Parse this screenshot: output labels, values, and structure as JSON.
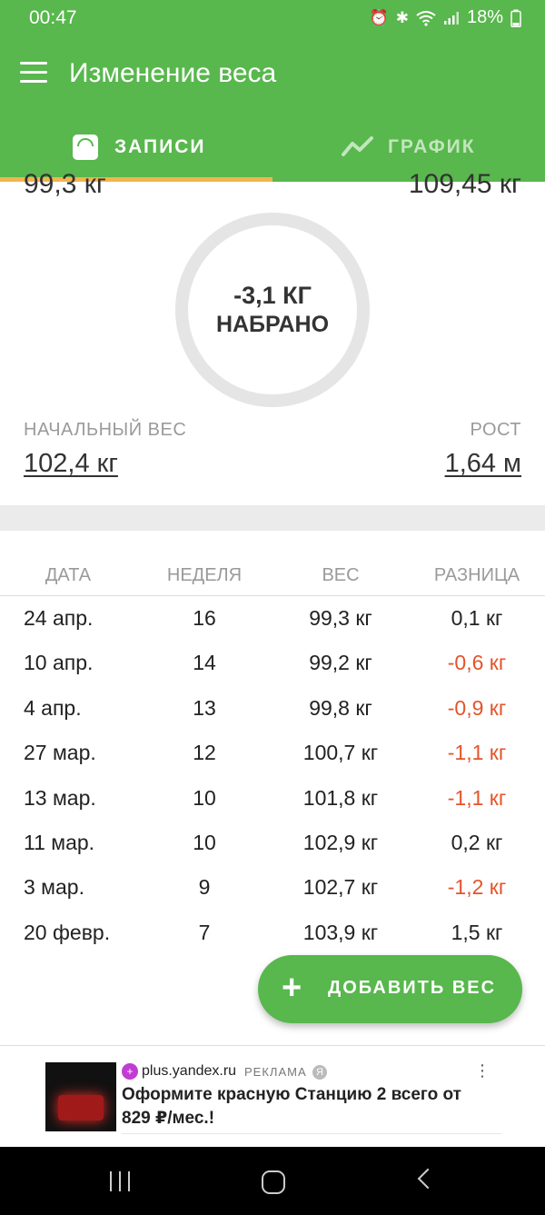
{
  "status_bar": {
    "time": "00:47",
    "battery": "18%",
    "icons": [
      "alarm-icon",
      "bluetooth-icon",
      "wifi-icon",
      "signal-icon",
      "battery-icon"
    ]
  },
  "app": {
    "title": "Изменение веса",
    "accent_color": "#58b74d",
    "indicator_color": "#f2b44e",
    "negative_color": "#e4542a"
  },
  "tabs": [
    {
      "label": "ЗАПИСИ",
      "icon": "scale-icon",
      "selected": true
    },
    {
      "label": "ГРАФИК",
      "icon": "chart-line-icon",
      "selected": false
    }
  ],
  "summary": {
    "current_weight": "99,3 кг",
    "goal_weight": "109,45 кг",
    "change_value": "-3,1 КГ",
    "change_label": "НАБРАНО",
    "start_weight_label": "НАЧАЛЬНЫЙ ВЕС",
    "start_weight": "102,4 кг",
    "height_label": "РОСТ",
    "height": "1,64 м"
  },
  "table": {
    "headers": [
      "ДАТА",
      "НЕДЕЛЯ",
      "ВЕС",
      "РАЗНИЦА"
    ],
    "rows": [
      {
        "date": "24 апр.",
        "week": "16",
        "weight": "99,3 кг",
        "diff": "0,1 кг",
        "negative": false
      },
      {
        "date": "10 апр.",
        "week": "14",
        "weight": "99,2 кг",
        "diff": "-0,6 кг",
        "negative": true
      },
      {
        "date": "4 апр.",
        "week": "13",
        "weight": "99,8 кг",
        "diff": "-0,9 кг",
        "negative": true
      },
      {
        "date": "27 мар.",
        "week": "12",
        "weight": "100,7 кг",
        "diff": "-1,1 кг",
        "negative": true
      },
      {
        "date": "13 мар.",
        "week": "10",
        "weight": "101,8 кг",
        "diff": "-1,1 кг",
        "negative": true
      },
      {
        "date": "11 мар.",
        "week": "10",
        "weight": "102,9 кг",
        "diff": "0,2 кг",
        "negative": false
      },
      {
        "date": "3 мар.",
        "week": "9",
        "weight": "102,7 кг",
        "diff": "-1,2 кг",
        "negative": true
      },
      {
        "date": "20 февр.",
        "week": "7",
        "weight": "103,9 кг",
        "diff": "1,5 кг",
        "negative": false
      }
    ]
  },
  "fab": {
    "icon": "plus-icon",
    "label": "ДОБАВИТЬ ВЕС"
  },
  "ad": {
    "domain": "plus.yandex.ru",
    "badge": "РЕКЛАМА",
    "text": "Оформите красную Станцию 2 всего от 829 ₽/мес.!"
  }
}
